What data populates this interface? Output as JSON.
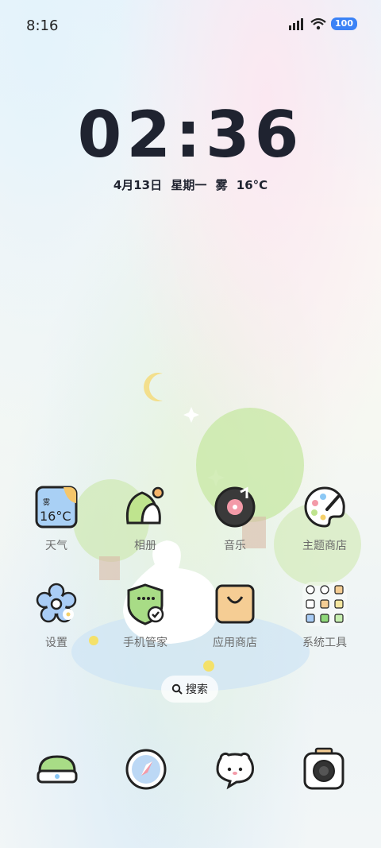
{
  "status_bar": {
    "time": "8:16",
    "battery": "100"
  },
  "lock_clock": {
    "time": "02:36",
    "date": "4月13日  星期一  雾  16°C"
  },
  "weather_icon": {
    "condition": "雾",
    "temp": "16°C"
  },
  "apps": [
    {
      "label": "天气"
    },
    {
      "label": "相册"
    },
    {
      "label": "音乐"
    },
    {
      "label": "主题商店"
    },
    {
      "label": "设置"
    },
    {
      "label": "手机管家"
    },
    {
      "label": "应用商店"
    },
    {
      "label": "系统工具"
    }
  ],
  "search": {
    "label": "搜索"
  }
}
